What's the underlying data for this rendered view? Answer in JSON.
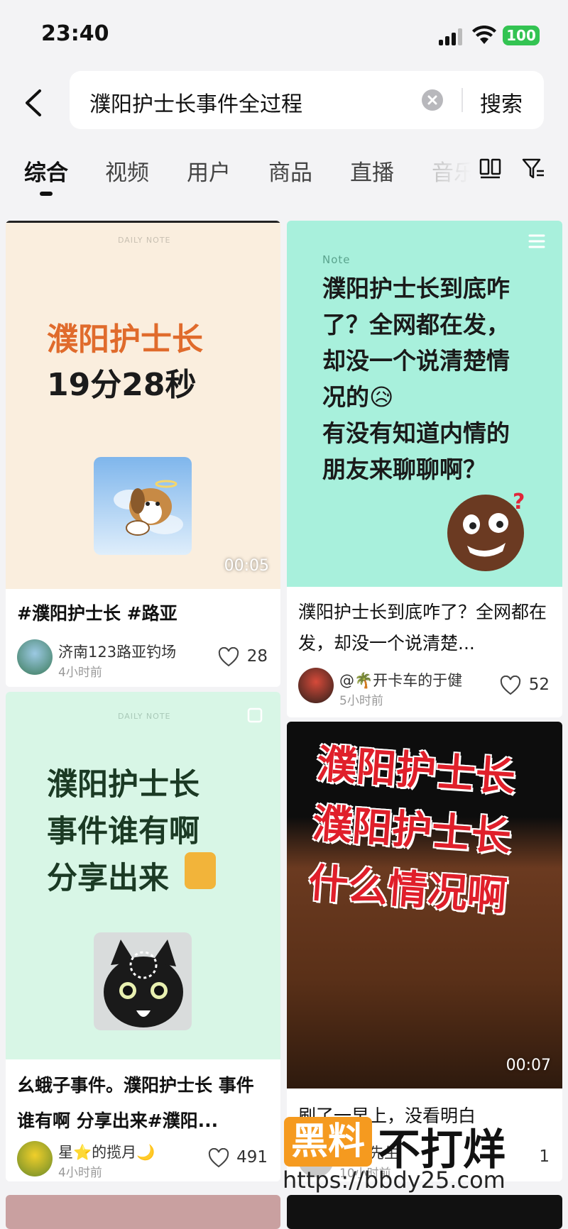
{
  "status": {
    "time": "23:40",
    "battery": "100"
  },
  "search": {
    "query": "濮阳护士长事件全过程",
    "button": "搜索"
  },
  "tabs": [
    {
      "label": "综合"
    },
    {
      "label": "视频"
    },
    {
      "label": "用户"
    },
    {
      "label": "商品"
    },
    {
      "label": "直播"
    },
    {
      "label": "音乐"
    }
  ],
  "cards": [
    {
      "thumb_tag": "DAILY NOTE",
      "thumb_line1": "濮阳护士长",
      "thumb_line2": "19分28秒",
      "duration": "00:05",
      "title": "#濮阳护士长 #路亚",
      "author": "济南123路亚钓场",
      "time": "4小时前",
      "likes": "28"
    },
    {
      "thumb_tag": "Note",
      "thumb_lines": [
        "濮阳护士长到底咋",
        "了？全网都在发，",
        "却没一个说清楚情",
        "况的😥",
        "有没有知道内情的",
        "朋友来聊聊啊？"
      ],
      "title": "濮阳护士长到底咋了？全网都在发，却没一个说清楚...",
      "author": "@🌴开卡车的于健",
      "time": "5小时前",
      "likes": "52"
    },
    {
      "thumb_tag": "DAILY NOTE",
      "thumb_lines": [
        "濮阳护士长",
        "事件谁有啊",
        "分享出来"
      ],
      "title": "幺蛾子事件。濮阳护士长 事件谁有啊 分享出来#濮阳...",
      "author": "星⭐的揽月🌙",
      "time": "4小时前",
      "likes": "491"
    },
    {
      "thumb_lines": [
        "濮阳护士长",
        "濮阳护士长",
        "什么情况啊"
      ],
      "duration": "00:07",
      "title": "刷了一早上，没看明白",
      "author": "秘书先生",
      "time": "10小时前",
      "likes": "1"
    }
  ],
  "watermark": {
    "tag": "黑料",
    "text": "不打烊",
    "url": "https://bbdy25.com"
  },
  "colors": {
    "accent": "#e06b2c",
    "teal": "#2fa18a",
    "red": "#e01f2a"
  }
}
